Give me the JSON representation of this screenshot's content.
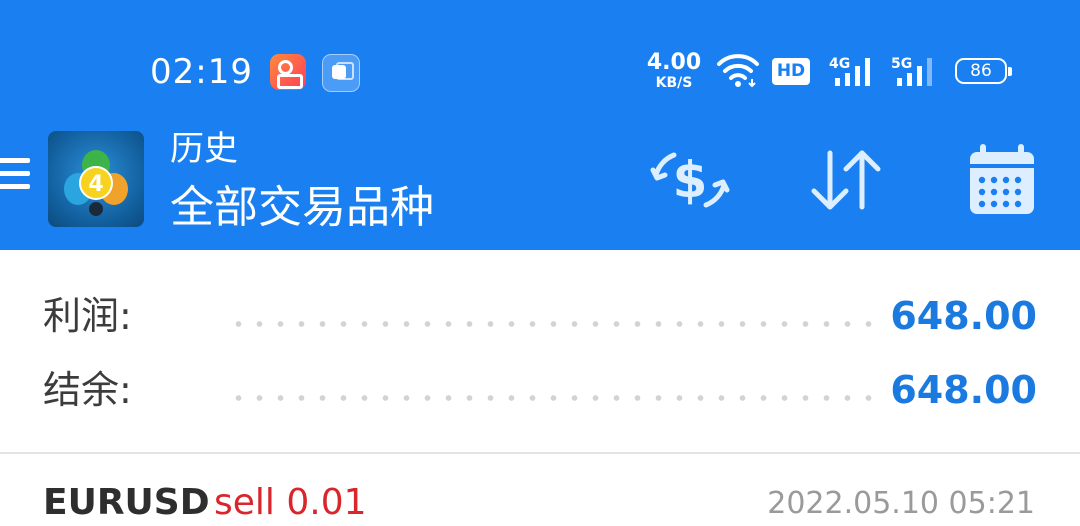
{
  "status_bar": {
    "time": "02:19",
    "net_speed_value": "4.00",
    "net_speed_unit": "KB/S",
    "hd_label": "HD",
    "sim1_label": "4G",
    "sim2_label": "5G",
    "battery_level": "86",
    "notification_icons": [
      "kuaishou-app-icon",
      "multitask-app-icon"
    ]
  },
  "toolbar": {
    "title": "历史",
    "subtitle": "全部交易品种",
    "logo_badge": "4",
    "actions": [
      "currency-exchange-icon",
      "sort-icon",
      "calendar-icon"
    ]
  },
  "summary": {
    "profit_label": "利润:",
    "profit_value": "648.00",
    "balance_label": "结余:",
    "balance_value": "648.00"
  },
  "deals": [
    {
      "symbol": "EURUSD",
      "type_volume": "sell 0.01",
      "time": "2022.05.10 05:21"
    }
  ],
  "colors": {
    "header_bg": "#1a80f2",
    "value_blue": "#1a7ae0",
    "sell_red": "#d9262c",
    "text_dark": "#3c3c3c",
    "text_gray": "#9a9a9a"
  }
}
